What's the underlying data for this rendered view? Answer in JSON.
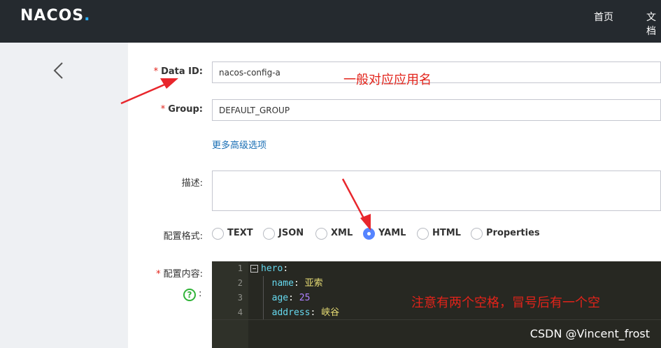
{
  "header": {
    "logo": "NACOS",
    "logo_dot": ".",
    "nav": [
      "首页",
      "文档"
    ]
  },
  "form": {
    "data_id": {
      "required_mark": "*",
      "label": "Data ID:",
      "value": "nacos-config-a"
    },
    "group": {
      "required_mark": "*",
      "label": "Group:",
      "value": "DEFAULT_GROUP"
    },
    "advanced_link": "更多高级选项",
    "description": {
      "label": "描述:",
      "value": ""
    },
    "format": {
      "label": "配置格式:",
      "options": [
        "TEXT",
        "JSON",
        "XML",
        "YAML",
        "HTML",
        "Properties"
      ],
      "selected": "YAML"
    },
    "content": {
      "required_mark": "*",
      "label": "配置内容:",
      "help_icon": "?",
      "help_colon": ":"
    }
  },
  "editor": {
    "lines": [
      {
        "num": "1",
        "key": "hero",
        "sep": ":",
        "value": "",
        "indent": ""
      },
      {
        "num": "2",
        "key": "name",
        "sep": ": ",
        "value": "亚索",
        "indent": "  "
      },
      {
        "num": "3",
        "key": "age",
        "sep": ": ",
        "value": "25",
        "indent": "  "
      },
      {
        "num": "4",
        "key": "address",
        "sep": ": ",
        "value": "峡谷",
        "indent": "  "
      }
    ]
  },
  "annotations": {
    "data_id_note": "一般对应应用名",
    "content_note": "注意有两个空格，冒号后有一个空"
  },
  "watermark": "CSDN @Vincent_frost",
  "colors": {
    "topbar": "#252a2f",
    "sidebar": "#eef0f3",
    "accent_blue": "#5584ff",
    "link_blue": "#1a6fb5",
    "required_red": "#e2231a",
    "editor_bg": "#272822",
    "help_green": "#30b338"
  }
}
